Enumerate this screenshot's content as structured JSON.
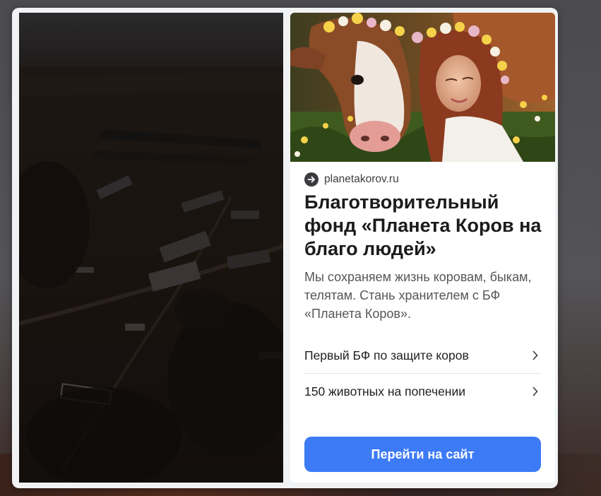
{
  "ad": {
    "domain": "planetakorov.ru",
    "headline": "Благотворительный фонд «Планета Коров на благо людей»",
    "description": "Мы сохраняем жизнь коровам, быкам, телятам. Стань хранителем с БФ «Планета Коров».",
    "links": [
      {
        "label": "Первый БФ по защите коров"
      },
      {
        "label": "150 животных на попечении"
      }
    ],
    "cta_label": "Перейти на сайт"
  },
  "colors": {
    "cta_background": "#3d7bf6",
    "cta_text": "#ffffff",
    "card_background": "#ffffff",
    "frame_background": "#f1f2f4",
    "video_background": "#0f0d0c"
  },
  "icons": {
    "domain_icon": "arrow-right-circle-icon",
    "link_icon": "chevron-right-icon"
  }
}
